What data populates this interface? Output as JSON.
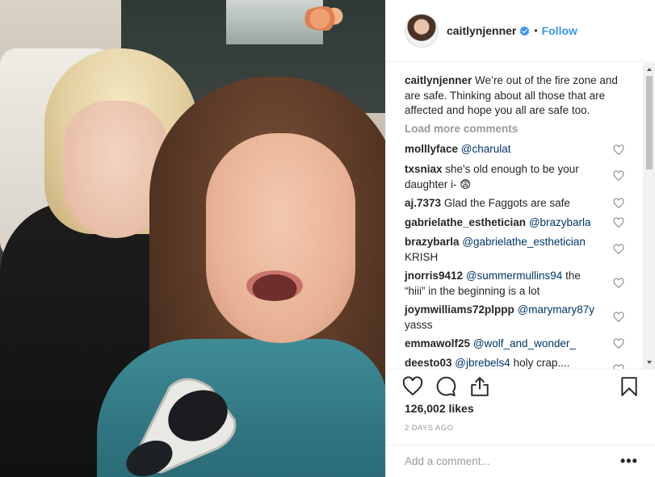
{
  "header": {
    "username": "caitlynjenner",
    "follow_label": "Follow",
    "separator": "•"
  },
  "caption": {
    "username": "caitlynjenner",
    "text": "We’re out of the fire zone and are safe. Thinking about all those that are affected and hope you all are safe too."
  },
  "load_more_label": "Load more comments",
  "comments": [
    {
      "user": "molllyface",
      "mention": "@charulat",
      "text": ""
    },
    {
      "user": "txsniax",
      "mention": "",
      "text": "she's old enough to be your daughter i- 😨"
    },
    {
      "user": "aj.7373",
      "mention": "",
      "text": "Glad the Faggots are safe"
    },
    {
      "user": "gabrielathe_esthetician",
      "mention": "@brazybarla",
      "text": ""
    },
    {
      "user": "brazybarla",
      "mention": "@gabrielathe_esthetician",
      "text": "KRISH"
    },
    {
      "user": "jnorris9412",
      "mention": "@summermullins94",
      "text": "the “hiii” in the beginning is a lot"
    },
    {
      "user": "joymwilliams72plppp",
      "mention": "@marymary87y",
      "text": "yasss"
    },
    {
      "user": "emmawolf25",
      "mention": "@wolf_and_wonder_",
      "text": ""
    },
    {
      "user": "deesto03",
      "mention": "@jbrebels4",
      "text": "holy crap...."
    }
  ],
  "likes": "126,002 likes",
  "timestamp": "2 DAYS AGO",
  "add_comment": {
    "placeholder": "Add a comment..."
  },
  "more_label": "•••",
  "colors": {
    "link": "#3897f0",
    "mention": "#003569",
    "muted": "#999999",
    "text": "#262626"
  }
}
